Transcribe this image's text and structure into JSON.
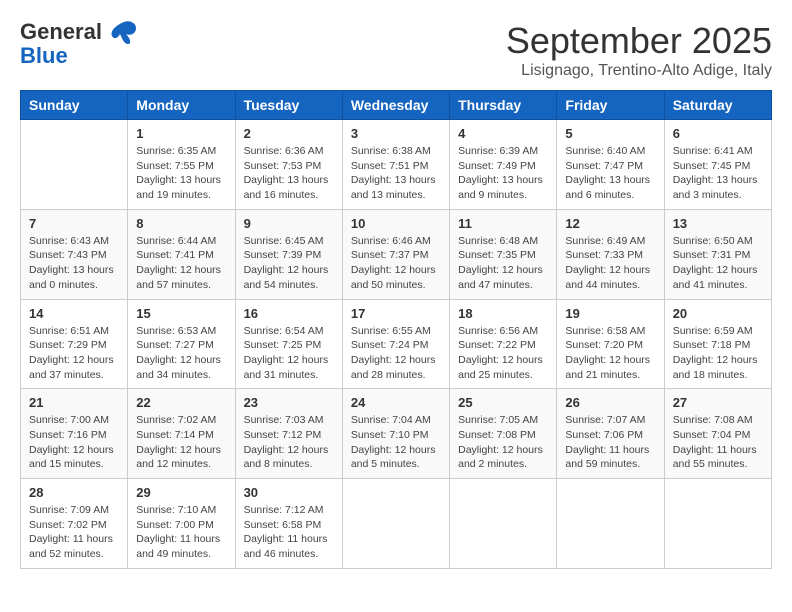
{
  "header": {
    "logo_line1": "General",
    "logo_line2": "Blue",
    "month": "September 2025",
    "location": "Lisignago, Trentino-Alto Adige, Italy"
  },
  "weekdays": [
    "Sunday",
    "Monday",
    "Tuesday",
    "Wednesday",
    "Thursday",
    "Friday",
    "Saturday"
  ],
  "weeks": [
    [
      {
        "day": "",
        "info": ""
      },
      {
        "day": "1",
        "info": "Sunrise: 6:35 AM\nSunset: 7:55 PM\nDaylight: 13 hours\nand 19 minutes."
      },
      {
        "day": "2",
        "info": "Sunrise: 6:36 AM\nSunset: 7:53 PM\nDaylight: 13 hours\nand 16 minutes."
      },
      {
        "day": "3",
        "info": "Sunrise: 6:38 AM\nSunset: 7:51 PM\nDaylight: 13 hours\nand 13 minutes."
      },
      {
        "day": "4",
        "info": "Sunrise: 6:39 AM\nSunset: 7:49 PM\nDaylight: 13 hours\nand 9 minutes."
      },
      {
        "day": "5",
        "info": "Sunrise: 6:40 AM\nSunset: 7:47 PM\nDaylight: 13 hours\nand 6 minutes."
      },
      {
        "day": "6",
        "info": "Sunrise: 6:41 AM\nSunset: 7:45 PM\nDaylight: 13 hours\nand 3 minutes."
      }
    ],
    [
      {
        "day": "7",
        "info": "Sunrise: 6:43 AM\nSunset: 7:43 PM\nDaylight: 13 hours\nand 0 minutes."
      },
      {
        "day": "8",
        "info": "Sunrise: 6:44 AM\nSunset: 7:41 PM\nDaylight: 12 hours\nand 57 minutes."
      },
      {
        "day": "9",
        "info": "Sunrise: 6:45 AM\nSunset: 7:39 PM\nDaylight: 12 hours\nand 54 minutes."
      },
      {
        "day": "10",
        "info": "Sunrise: 6:46 AM\nSunset: 7:37 PM\nDaylight: 12 hours\nand 50 minutes."
      },
      {
        "day": "11",
        "info": "Sunrise: 6:48 AM\nSunset: 7:35 PM\nDaylight: 12 hours\nand 47 minutes."
      },
      {
        "day": "12",
        "info": "Sunrise: 6:49 AM\nSunset: 7:33 PM\nDaylight: 12 hours\nand 44 minutes."
      },
      {
        "day": "13",
        "info": "Sunrise: 6:50 AM\nSunset: 7:31 PM\nDaylight: 12 hours\nand 41 minutes."
      }
    ],
    [
      {
        "day": "14",
        "info": "Sunrise: 6:51 AM\nSunset: 7:29 PM\nDaylight: 12 hours\nand 37 minutes."
      },
      {
        "day": "15",
        "info": "Sunrise: 6:53 AM\nSunset: 7:27 PM\nDaylight: 12 hours\nand 34 minutes."
      },
      {
        "day": "16",
        "info": "Sunrise: 6:54 AM\nSunset: 7:25 PM\nDaylight: 12 hours\nand 31 minutes."
      },
      {
        "day": "17",
        "info": "Sunrise: 6:55 AM\nSunset: 7:24 PM\nDaylight: 12 hours\nand 28 minutes."
      },
      {
        "day": "18",
        "info": "Sunrise: 6:56 AM\nSunset: 7:22 PM\nDaylight: 12 hours\nand 25 minutes."
      },
      {
        "day": "19",
        "info": "Sunrise: 6:58 AM\nSunset: 7:20 PM\nDaylight: 12 hours\nand 21 minutes."
      },
      {
        "day": "20",
        "info": "Sunrise: 6:59 AM\nSunset: 7:18 PM\nDaylight: 12 hours\nand 18 minutes."
      }
    ],
    [
      {
        "day": "21",
        "info": "Sunrise: 7:00 AM\nSunset: 7:16 PM\nDaylight: 12 hours\nand 15 minutes."
      },
      {
        "day": "22",
        "info": "Sunrise: 7:02 AM\nSunset: 7:14 PM\nDaylight: 12 hours\nand 12 minutes."
      },
      {
        "day": "23",
        "info": "Sunrise: 7:03 AM\nSunset: 7:12 PM\nDaylight: 12 hours\nand 8 minutes."
      },
      {
        "day": "24",
        "info": "Sunrise: 7:04 AM\nSunset: 7:10 PM\nDaylight: 12 hours\nand 5 minutes."
      },
      {
        "day": "25",
        "info": "Sunrise: 7:05 AM\nSunset: 7:08 PM\nDaylight: 12 hours\nand 2 minutes."
      },
      {
        "day": "26",
        "info": "Sunrise: 7:07 AM\nSunset: 7:06 PM\nDaylight: 11 hours\nand 59 minutes."
      },
      {
        "day": "27",
        "info": "Sunrise: 7:08 AM\nSunset: 7:04 PM\nDaylight: 11 hours\nand 55 minutes."
      }
    ],
    [
      {
        "day": "28",
        "info": "Sunrise: 7:09 AM\nSunset: 7:02 PM\nDaylight: 11 hours\nand 52 minutes."
      },
      {
        "day": "29",
        "info": "Sunrise: 7:10 AM\nSunset: 7:00 PM\nDaylight: 11 hours\nand 49 minutes."
      },
      {
        "day": "30",
        "info": "Sunrise: 7:12 AM\nSunset: 6:58 PM\nDaylight: 11 hours\nand 46 minutes."
      },
      {
        "day": "",
        "info": ""
      },
      {
        "day": "",
        "info": ""
      },
      {
        "day": "",
        "info": ""
      },
      {
        "day": "",
        "info": ""
      }
    ]
  ]
}
